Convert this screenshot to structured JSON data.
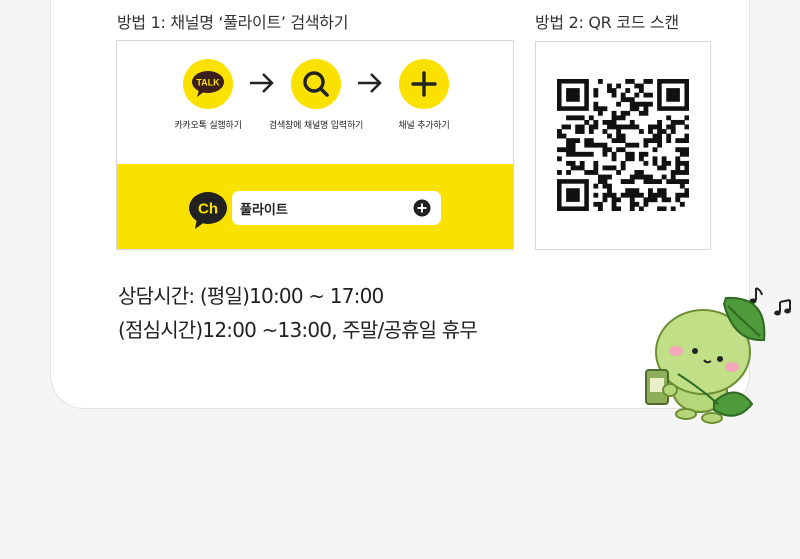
{
  "method1": {
    "title": "방법 1: 채널명 ‘풀라이트’ 검색하기",
    "steps": [
      {
        "icon": "kakaotalk-icon",
        "badge": "TALK",
        "label": "카카오톡 실행하기"
      },
      {
        "icon": "search-icon",
        "label": "검색창에 채널명 입력하기"
      },
      {
        "icon": "plus-icon",
        "label": "채널 추가하기"
      }
    ],
    "channel_badge": "Ch",
    "channel_name": "풀라이트"
  },
  "method2": {
    "title": "방법 2: QR 코드 스캔",
    "qr_icon": "qr-code"
  },
  "hours": {
    "line1": "상담시간: (평일)10:00 ~ 17:00",
    "line2": "(점심시간)12:00 ~13:00, 주말/공휴일 휴무"
  },
  "colors": {
    "kakao_yellow": "#fae100",
    "text": "#222222",
    "mascot_green": "#b5d77a"
  }
}
